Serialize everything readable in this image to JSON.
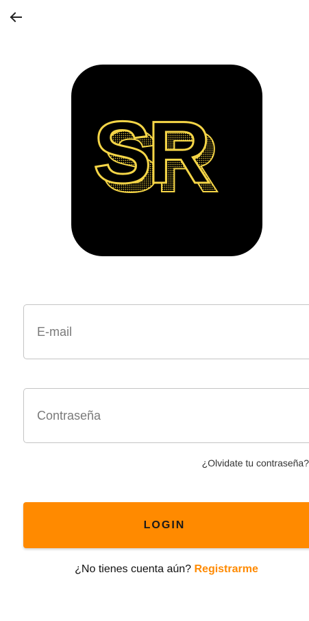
{
  "header": {
    "back_icon": "arrow-left-icon"
  },
  "logo": {
    "text": "SR",
    "background_color": "#000000",
    "accent_color": "#f5d547"
  },
  "form": {
    "email": {
      "placeholder": "E-mail",
      "value": ""
    },
    "password": {
      "placeholder": "Contraseña",
      "value": ""
    },
    "forgot_password_label": "¿Olvidate tu contraseña?",
    "login_label": "LOGIN"
  },
  "signup": {
    "prompt": "¿No tienes cuenta aún?",
    "link_label": "Registrarme"
  },
  "colors": {
    "accent": "#ff8a00",
    "field_border": "#c4c4c4"
  }
}
